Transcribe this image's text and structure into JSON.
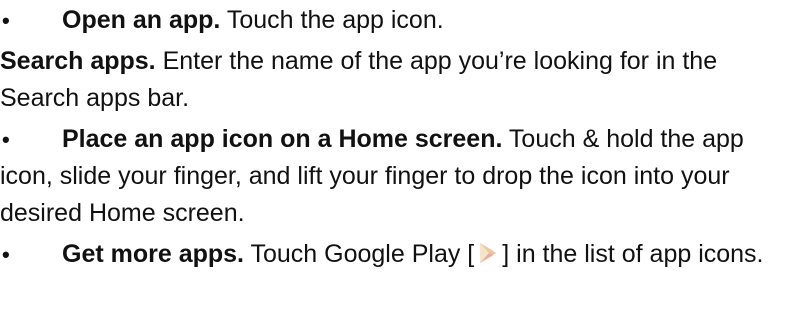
{
  "items": [
    {
      "bullet": "•",
      "bold": "Open an app.",
      "text": " Touch the app icon."
    },
    {
      "bullet": "",
      "bold": "Search apps.",
      "text": " Enter the name of the app you’re looking for in the Search apps bar."
    },
    {
      "bullet": "•",
      "bold": "Place an app icon on a Home screen.",
      "text": " Touch & hold the app icon, slide your finger, and lift your finger to drop the icon into your desired Home screen."
    },
    {
      "bullet": "•",
      "bold": "Get more apps.",
      "text_before": " Touch Google Play [",
      "icon": "google-play-icon",
      "text_after": "] in the list of app icons."
    }
  ]
}
